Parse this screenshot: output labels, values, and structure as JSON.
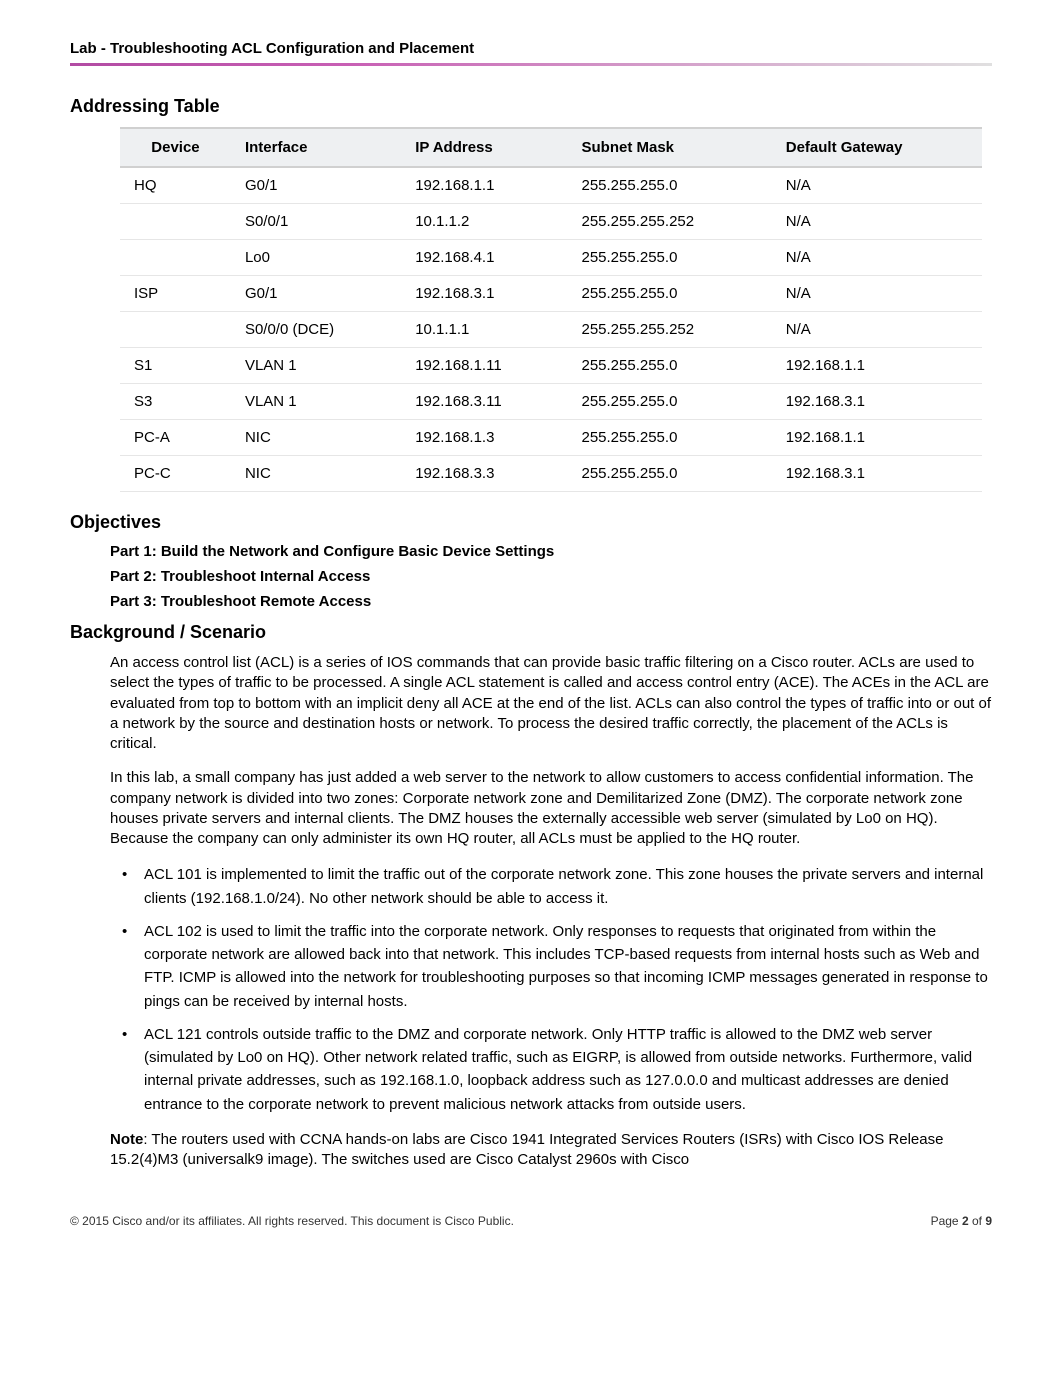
{
  "header": "Lab - Troubleshooting ACL Configuration and Placement",
  "sections": {
    "addressing": "Addressing Table",
    "objectives": "Objectives",
    "background": "Background / Scenario"
  },
  "table": {
    "headers": [
      "Device",
      "Interface",
      "IP Address",
      "Subnet Mask",
      "Default Gateway"
    ],
    "rows": [
      [
        "HQ",
        "G0/1",
        "192.168.1.1",
        "255.255.255.0",
        "N/A"
      ],
      [
        "",
        "S0/0/1",
        "10.1.1.2",
        "255.255.255.252",
        "N/A"
      ],
      [
        "",
        "Lo0",
        "192.168.4.1",
        "255.255.255.0",
        "N/A"
      ],
      [
        "ISP",
        "G0/1",
        "192.168.3.1",
        "255.255.255.0",
        "N/A"
      ],
      [
        "",
        "S0/0/0 (DCE)",
        "10.1.1.1",
        "255.255.255.252",
        "N/A"
      ],
      [
        "S1",
        "VLAN 1",
        "192.168.1.11",
        "255.255.255.0",
        "192.168.1.1"
      ],
      [
        "S3",
        "VLAN 1",
        "192.168.3.11",
        "255.255.255.0",
        "192.168.3.1"
      ],
      [
        "PC-A",
        "NIC",
        "192.168.1.3",
        "255.255.255.0",
        "192.168.1.1"
      ],
      [
        "PC-C",
        "NIC",
        "192.168.3.3",
        "255.255.255.0",
        "192.168.3.1"
      ]
    ]
  },
  "objectives": [
    "Part 1: Build the Network and Configure Basic Device Settings",
    "Part 2: Troubleshoot Internal Access",
    "Part 3: Troubleshoot Remote Access"
  ],
  "paras": {
    "p1": "An access control list (ACL) is a series of IOS commands that can provide basic traffic filtering on a Cisco router. ACLs are used to select the types of traffic to be processed. A single ACL statement is called and access control entry (ACE). The ACEs in the ACL are evaluated from top to bottom with an implicit deny all ACE at the end of the list. ACLs can also control the types of traffic into or out of a network by the source and destination hosts or network. To process the desired traffic correctly, the placement of the ACLs is critical.",
    "p2": "In this lab, a small company has just added a web server to the network to allow customers to access confidential information. The company network is divided into two zones: Corporate network zone and Demilitarized Zone (DMZ). The corporate network zone houses private servers and internal clients. The DMZ houses the externally accessible web server (simulated by Lo0 on HQ). Because the company can only administer its own HQ router, all ACLs must be applied to the HQ router."
  },
  "bullets": [
    "ACL 101 is implemented to limit the traffic out of the corporate network zone. This zone houses the private servers and internal clients (192.168.1.0/24). No other network should be able to access it.",
    "ACL 102 is used to limit the traffic into the corporate network. Only responses to requests that originated from within the corporate network are allowed back into that network. This includes TCP-based requests from internal hosts such as Web and FTP. ICMP is allowed into the network for troubleshooting purposes so that incoming ICMP messages generated in response to pings can be received by internal hosts.",
    "ACL 121 controls outside traffic to the DMZ and corporate network. Only HTTP traffic is allowed to the DMZ web server (simulated by Lo0 on HQ). Other network related traffic, such as EIGRP, is allowed from outside networks. Furthermore, valid internal private addresses, such as 192.168.1.0, loopback address such as 127.0.0.0 and multicast addresses are denied entrance to the corporate network to prevent malicious network attacks from outside users."
  ],
  "note_label": "Note",
  "note_body": ": The routers used with CCNA hands-on labs are Cisco 1941 Integrated Services Routers (ISRs) with Cisco IOS Release 15.2(4)M3 (universalk9 image). The switches used are Cisco Catalyst 2960s with Cisco",
  "footer": {
    "left": "© 2015 Cisco and/or its affiliates. All rights reserved. This document is Cisco Public.",
    "right_prefix": "Page ",
    "right_page": "2",
    "right_of": " of ",
    "right_total": "9"
  }
}
